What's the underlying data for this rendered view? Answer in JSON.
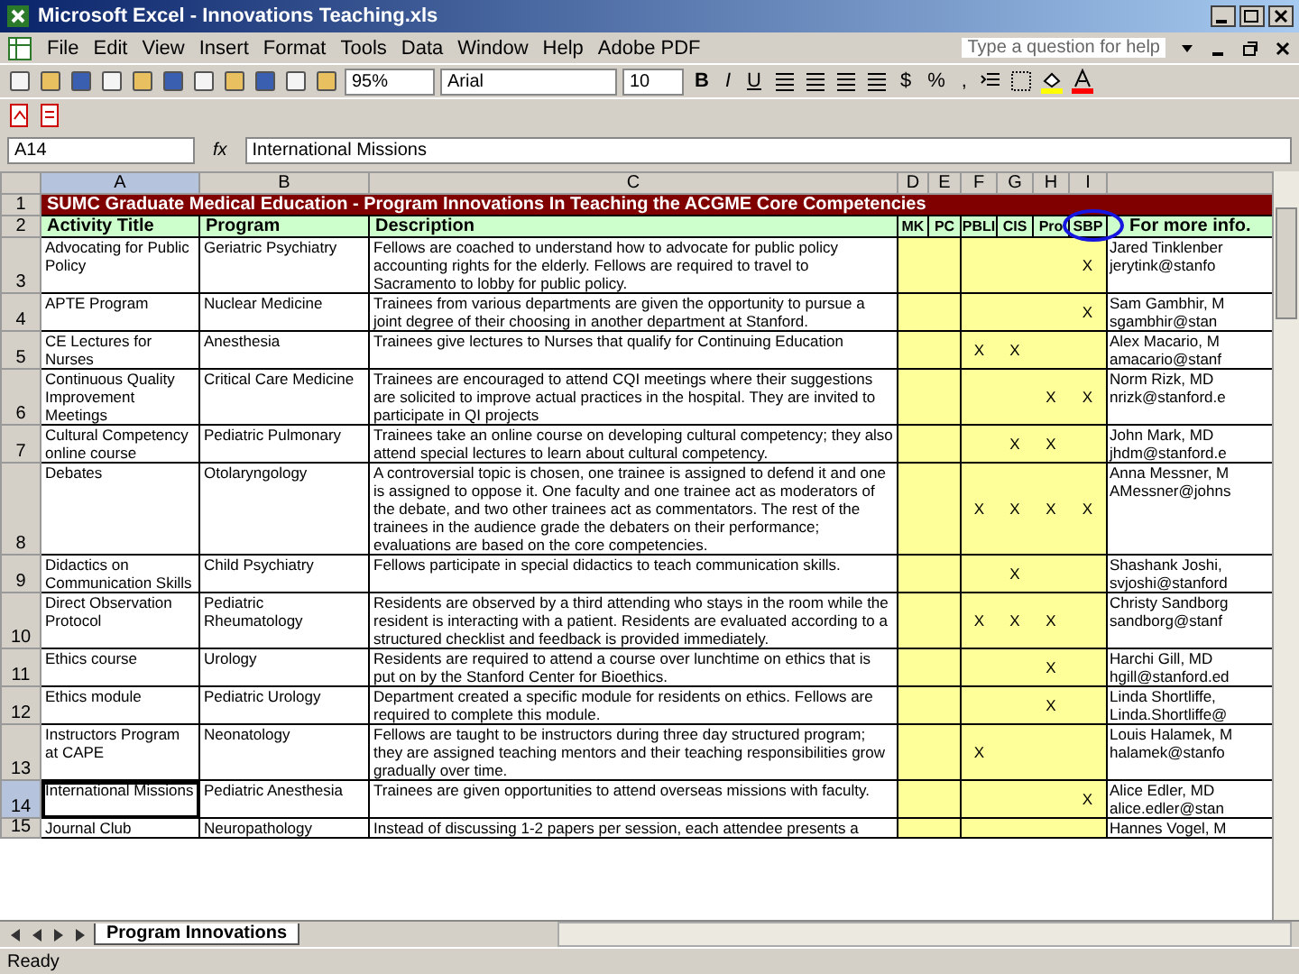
{
  "window": {
    "title": "Microsoft Excel - Innovations Teaching.xls"
  },
  "menu": [
    "File",
    "Edit",
    "View",
    "Insert",
    "Format",
    "Tools",
    "Data",
    "Window",
    "Help",
    "Adobe PDF"
  ],
  "help_box": {
    "placeholder": "Type a question for help"
  },
  "toolbar": {
    "zoom": "95%",
    "font": "Arial",
    "font_size": "10",
    "format_buttons": [
      "B",
      "I",
      "U"
    ],
    "number_buttons": [
      "$",
      "%",
      ","
    ]
  },
  "formula_bar": {
    "name_box": "A14",
    "fx": "fx",
    "value": "International Missions"
  },
  "columns": [
    {
      "letter": "A",
      "selected": true
    },
    {
      "letter": "B",
      "selected": false
    },
    {
      "letter": "C",
      "selected": false
    },
    {
      "letter": "D",
      "selected": false
    },
    {
      "letter": "E",
      "selected": false
    },
    {
      "letter": "F",
      "selected": false
    },
    {
      "letter": "G",
      "selected": false
    },
    {
      "letter": "H",
      "selected": false
    },
    {
      "letter": "I",
      "selected": false
    }
  ],
  "title_row": {
    "row": "1",
    "text": "SUMC Graduate Medical Education - Program Innovations In Teaching the ACGME Core Competencies"
  },
  "header_row": {
    "row": "2",
    "cells": [
      "Activity Title",
      "Program",
      "Description",
      "MK",
      "PC",
      "PBLI",
      "CIS",
      "Pro",
      "SBP",
      "For more info."
    ]
  },
  "rows": [
    {
      "row": "3",
      "selected": false,
      "activity": "Advocating for Public Policy",
      "program": "Geriatric Psychiatry",
      "description": "Fellows are coached to understand how to advocate for public policy accounting rights for the elderly. Fellows are required to travel to Sacramento to lobby for public policy.",
      "marks": {
        "sbp": "X"
      },
      "contact": [
        "Jared Tinklenber",
        "jerytink@stanfo"
      ]
    },
    {
      "row": "4",
      "selected": false,
      "activity": "APTE Program",
      "program": "Nuclear Medicine",
      "description": "Trainees from various departments are given the opportunity to pursue a joint degree of their choosing in another department at Stanford.",
      "marks": {
        "sbp": "X"
      },
      "contact": [
        "Sam Gambhir, M",
        "sgambhir@stan"
      ]
    },
    {
      "row": "5",
      "selected": false,
      "activity": "CE Lectures for Nurses",
      "program": "Anesthesia",
      "description": "Trainees give lectures to Nurses that qualify for Continuing Education",
      "marks": {
        "pbli": "X",
        "cis": "X"
      },
      "contact": [
        "Alex Macario, M",
        "amacario@stanf"
      ]
    },
    {
      "row": "6",
      "selected": false,
      "activity": "Continuous Quality Improvement Meetings",
      "program": "Critical Care Medicine",
      "description": "Trainees are encouraged to attend CQI meetings where their suggestions are solicited to improve actual practices in the hospital. They are invited to participate in QI projects",
      "marks": {
        "prof": "X",
        "sbp": "X"
      },
      "contact": [
        "Norm Rizk, MD",
        "nrizk@stanford.e"
      ]
    },
    {
      "row": "7",
      "selected": false,
      "activity": "Cultural Competency online course",
      "program": "Pediatric Pulmonary",
      "description": "Trainees take an online course on developing cultural competency; they also attend special lectures to learn about cultural competency.",
      "marks": {
        "cis": "X",
        "prof": "X"
      },
      "contact": [
        "John Mark, MD",
        "jhdm@stanford.e"
      ]
    },
    {
      "row": "8",
      "selected": false,
      "activity": "Debates",
      "program": "Otolaryngology",
      "description": "A controversial topic is chosen, one trainee is assigned to defend it and one is assigned to oppose it. One faculty and one trainee act as moderators of the debate, and two other trainees act as commentators. The rest of the trainees in the audience grade the debaters on their performance; evaluations are based on the core competencies.",
      "marks": {
        "pbli": "X",
        "cis": "X",
        "prof": "X",
        "sbp": "X"
      },
      "contact": [
        "Anna Messner, M",
        "AMessner@johns"
      ]
    },
    {
      "row": "9",
      "selected": false,
      "activity": "Didactics on Communication Skills",
      "program": "Child Psychiatry",
      "description": "Fellows participate in special didactics to teach communication skills.",
      "marks": {
        "cis": "X"
      },
      "contact": [
        "Shashank Joshi,",
        "svjoshi@stanford"
      ]
    },
    {
      "row": "10",
      "selected": false,
      "activity": "Direct Observation Protocol",
      "program": "Pediatric Rheumatology",
      "description": "Residents are observed by a third attending who stays in the room while the resident is interacting with a patient. Residents are evaluated according to a structured checklist and feedback is provided immediately.",
      "marks": {
        "pbli": "X",
        "cis": "X",
        "prof": "X"
      },
      "contact": [
        "Christy Sandborg",
        "sandborg@stanf"
      ]
    },
    {
      "row": "11",
      "selected": false,
      "activity": "Ethics course",
      "program": "Urology",
      "description": "Residents are required to attend a course over lunchtime on ethics that is put on by the Stanford Center for Bioethics.",
      "marks": {
        "prof": "X"
      },
      "contact": [
        "Harchi Gill, MD",
        "hgill@stanford.ed"
      ]
    },
    {
      "row": "12",
      "selected": false,
      "activity": "Ethics module",
      "program": "Pediatric Urology",
      "description": "Department created a specific module for residents on ethics. Fellows are required to complete this module.",
      "marks": {
        "prof": "X"
      },
      "contact": [
        "Linda Shortliffe,",
        "Linda.Shortliffe@"
      ]
    },
    {
      "row": "13",
      "selected": false,
      "activity": "Instructors Program at CAPE",
      "program": "Neonatology",
      "description": "Fellows are taught to be instructors during three day structured program; they are assigned teaching mentors and their teaching responsibilities grow gradually over time.",
      "marks": {
        "pbli": "X"
      },
      "contact": [
        "Louis Halamek, M",
        "halamek@stanfo"
      ]
    },
    {
      "row": "14",
      "selected": true,
      "activity": "International Missions",
      "program": "Pediatric Anesthesia",
      "description": "Trainees are given opportunities to attend overseas missions with faculty.",
      "marks": {
        "sbp": "X"
      },
      "contact": [
        "Alice Edler, MD",
        "alice.edler@stan"
      ]
    },
    {
      "row": "15",
      "selected": false,
      "activity": "Journal Club",
      "program": "Neuropathology",
      "description": "Instead of discussing 1-2 papers per session, each attendee presents a",
      "contact": [
        "Hannes Vogel, M"
      ]
    }
  ],
  "sheet_tabs": [
    {
      "label": "Program Innovations",
      "selected": true
    }
  ],
  "status_bar": "Ready"
}
